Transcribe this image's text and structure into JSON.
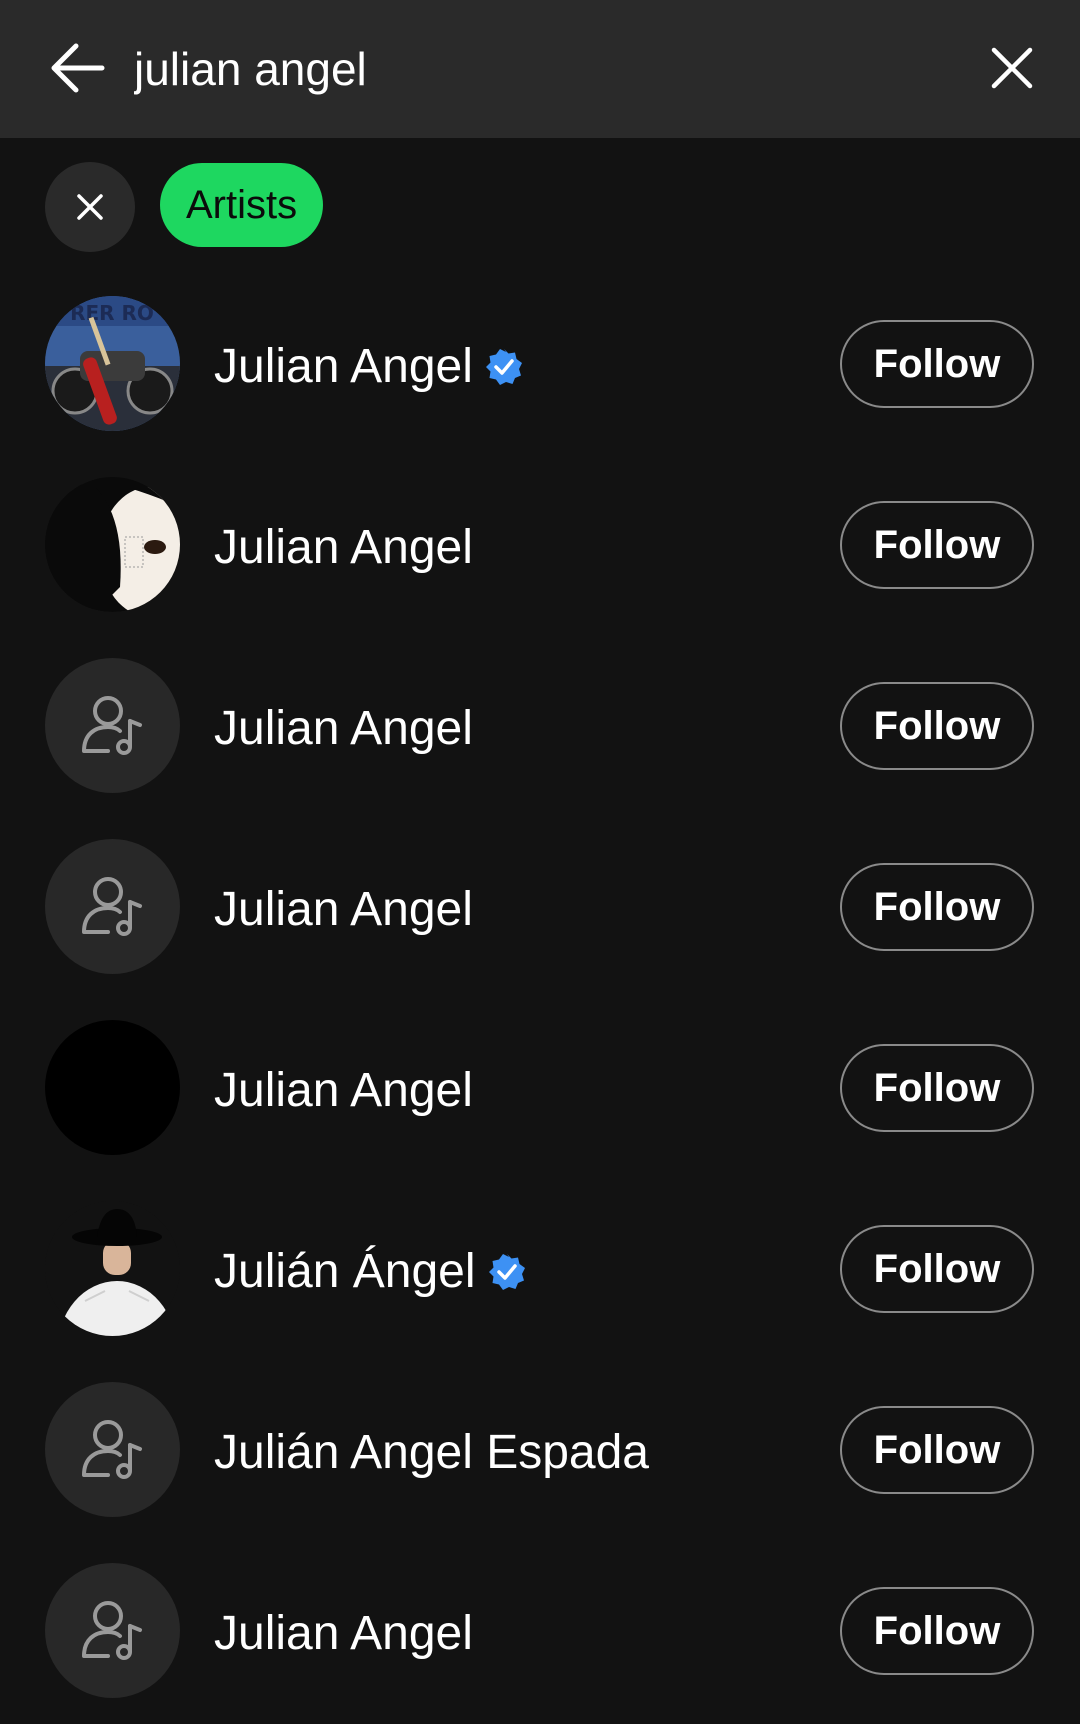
{
  "search": {
    "query": "julian angel",
    "back_icon": "arrow-left-icon",
    "clear_icon": "close-icon"
  },
  "filters": {
    "clear_icon": "close-icon",
    "active_chip": "Artists",
    "active_color": "#1ed760"
  },
  "results": [
    {
      "name": "Julian Angel",
      "verified": true,
      "avatar": "motorcycle-guitar-photo",
      "follow_label": "Follow"
    },
    {
      "name": "Julian Angel",
      "verified": false,
      "avatar": "face-photo",
      "follow_label": "Follow"
    },
    {
      "name": "Julian Angel",
      "verified": false,
      "avatar": "artist-placeholder-icon",
      "follow_label": "Follow"
    },
    {
      "name": "Julian Angel",
      "verified": false,
      "avatar": "artist-placeholder-icon",
      "follow_label": "Follow"
    },
    {
      "name": "Julian Angel",
      "verified": false,
      "avatar": "black-photo",
      "follow_label": "Follow"
    },
    {
      "name": "Julián Ángel",
      "verified": true,
      "avatar": "cowboy-hat-photo",
      "follow_label": "Follow"
    },
    {
      "name": "Julián Angel Espada",
      "verified": false,
      "avatar": "artist-placeholder-icon",
      "follow_label": "Follow"
    },
    {
      "name": "Julian Angel",
      "verified": false,
      "avatar": "artist-placeholder-icon",
      "follow_label": "Follow"
    }
  ],
  "colors": {
    "background": "#121212",
    "header": "#2a2a2a",
    "verified_badge": "#3d91f4"
  }
}
